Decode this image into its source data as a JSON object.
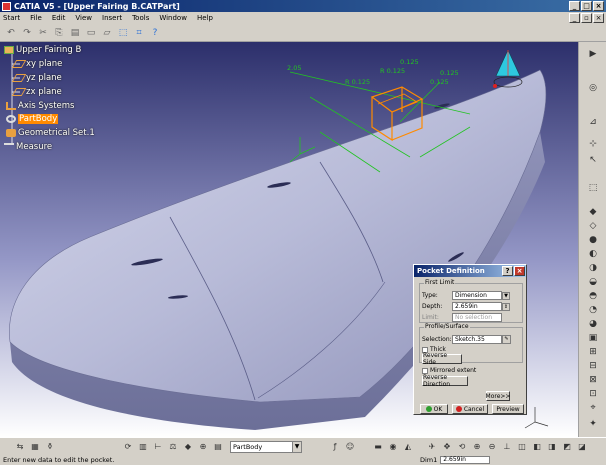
{
  "window": {
    "title": "CATIA V5 - [Upper Fairing B.CATPart]"
  },
  "menu": [
    "Start",
    "File",
    "Edit",
    "View",
    "Insert",
    "Tools",
    "Window",
    "Help"
  ],
  "tree": {
    "root": "Upper Fairing B",
    "items": [
      {
        "label": "xy plane"
      },
      {
        "label": "yz plane"
      },
      {
        "label": "zx plane"
      },
      {
        "label": "Axis Systems"
      },
      {
        "label": "PartBody"
      },
      {
        "label": "Geometrical Set.1"
      },
      {
        "label": "Measure"
      }
    ]
  },
  "sketch_dims": [
    "2.05",
    "R 0.125",
    "R 0.125",
    "0.125",
    "0.125",
    "0.125"
  ],
  "dialog": {
    "title": "Pocket Definition",
    "first_limit_label": "First Limit",
    "type_label": "Type:",
    "type_value": "Dimension",
    "depth_label": "Depth:",
    "depth_value": "2.659in",
    "limit_label": "Limit:",
    "limit_placeholder": "No selection",
    "profile_label": "Profile/Surface",
    "selection_label": "Selection:",
    "selection_value": "Sketch.35",
    "thick_label": "Thick",
    "reverse_side": "Reverse Side",
    "mirrored_label": "Mirrored extent",
    "reverse_direction": "Reverse Direction",
    "more": "More>>",
    "ok": "OK",
    "cancel": "Cancel",
    "preview": "Preview"
  },
  "bottom_toolbar": {
    "body_select": "PartBody"
  },
  "status": {
    "message": "Enter new data to edit the pocket.",
    "field_label": "Dim1",
    "field_value": "2.659in"
  },
  "colors": {
    "accent_orange": "#ff8a00",
    "model_fill": "#b8bbd8",
    "title_blue": "#0a246a"
  }
}
